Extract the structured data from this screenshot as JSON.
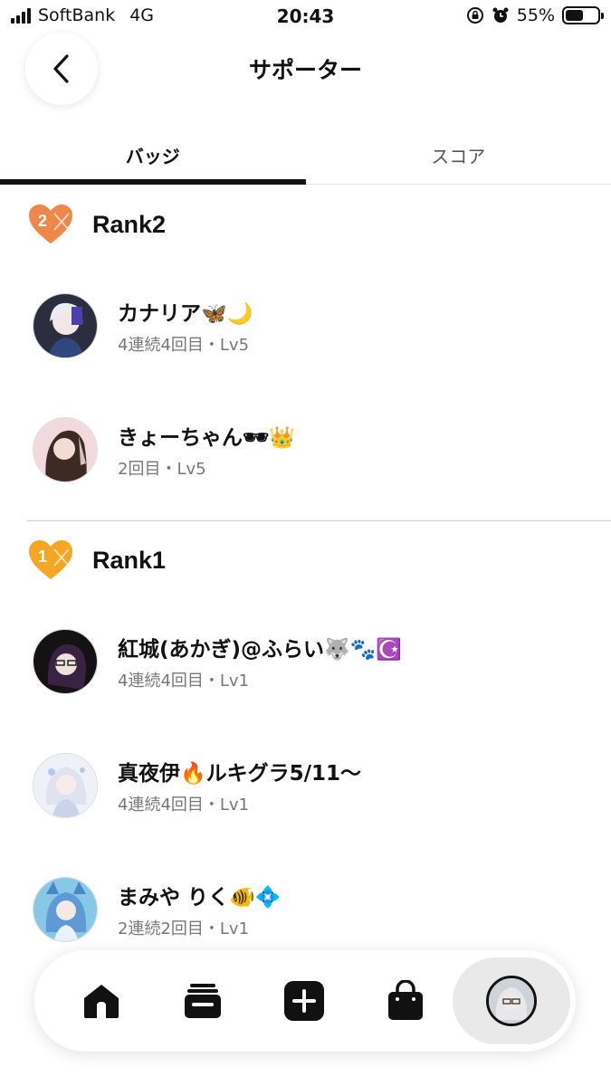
{
  "status_bar": {
    "carrier": "SoftBank",
    "network": "4G",
    "time": "20:43",
    "battery": "55%",
    "battery_level": 0.55,
    "icons": [
      "orientation-lock-icon",
      "alarm-icon"
    ]
  },
  "header": {
    "title": "サポーター",
    "back_icon": "chevron-left-icon"
  },
  "tabs": [
    {
      "label": "バッジ",
      "active": true
    },
    {
      "label": "スコア",
      "active": false
    }
  ],
  "ranks": [
    {
      "title": "Rank2",
      "badge_number": "2",
      "badge_color": "#f0874a",
      "users": [
        {
          "name": "カナリア🦋🌙",
          "meta": "4連続4回目・Lv5"
        },
        {
          "name": "きょーちゃん🕶👑",
          "meta": "2回目・Lv5"
        }
      ]
    },
    {
      "title": "Rank1",
      "badge_number": "1",
      "badge_color": "#f5a623",
      "users": [
        {
          "name": "紅城(あかぎ)@ふらい🐺🐾☪️",
          "meta": "4連続4回目・Lv1"
        },
        {
          "name": "真夜伊🔥ルキグラ5/11～",
          "meta": "4連続4回目・Lv1"
        },
        {
          "name": "まみや りく🐠💠",
          "meta": "2連続2回目・Lv1"
        }
      ]
    }
  ],
  "bottom_nav": {
    "items": [
      "home-icon",
      "inbox-icon",
      "plus-icon",
      "bag-icon",
      "profile-avatar"
    ]
  }
}
